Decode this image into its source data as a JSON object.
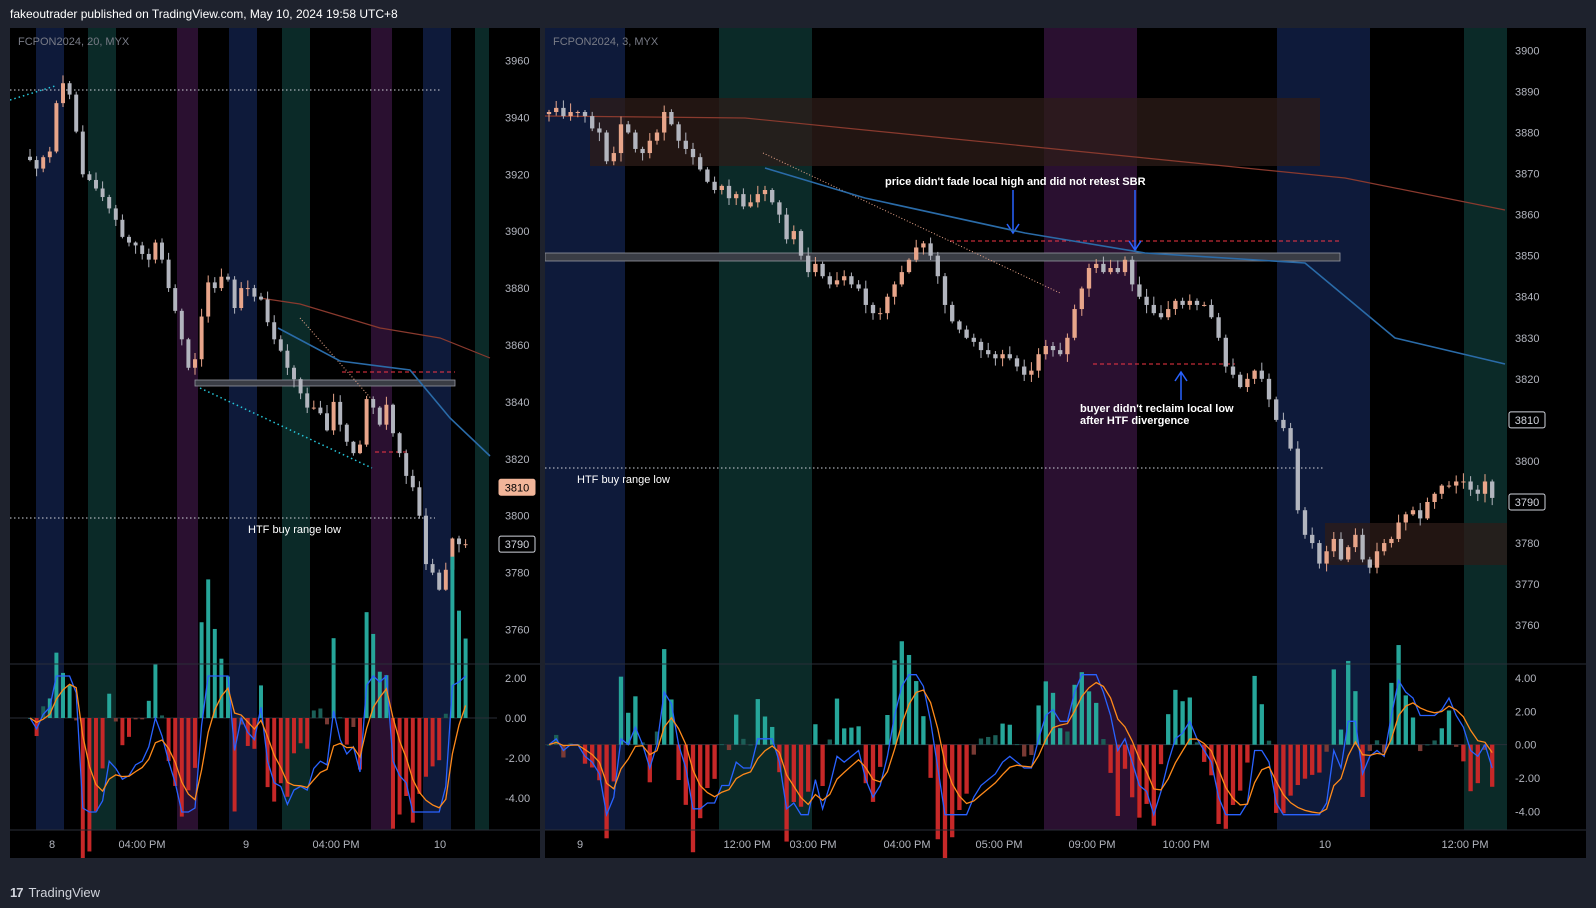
{
  "header": {
    "published": "fakeoutrader published on TradingView.com, May 10, 2024 19:58 UTC+8"
  },
  "footer": {
    "brand": "TradingView",
    "brand_icon": "tradingview-logo-icon"
  },
  "colors": {
    "up": "#e8a58a",
    "down": "#b2b5be",
    "ma_blue": "#2a6ba8",
    "ma_red": "#8a3a2e",
    "session_blue": "#0e1a3a",
    "session_teal": "#0b2a28",
    "session_purple": "#2a1030",
    "macd": "#2962ff",
    "signal": "#ff8a1a",
    "label_box": "#f2b599"
  },
  "chart_data": [
    {
      "type": "candlestick",
      "symbol_label": "FCPON2024, 20, MYX",
      "ylim": [
        3750,
        3970
      ],
      "y_ticks": [
        3760,
        3780,
        3800,
        3820,
        3840,
        3860,
        3880,
        3900,
        3920,
        3940,
        3960
      ],
      "x_ticks": [
        "8",
        "04:00 PM",
        "9",
        "04:00 PM",
        "10"
      ],
      "price_labels": [
        3810,
        3790
      ],
      "annotations": [
        "HTF buy range low"
      ],
      "oscillator": {
        "ylim": [
          -5.5,
          2.5
        ],
        "ticks": [
          "2.00",
          "0.00",
          "-2.00",
          "-4.00"
        ]
      },
      "close_series": [
        3925,
        3922,
        3926,
        3928,
        3945,
        3952,
        3948,
        3935,
        3920,
        3918,
        3915,
        3912,
        3908,
        3904,
        3898,
        3896,
        3895,
        3892,
        3890,
        3896,
        3890,
        3880,
        3872,
        3862,
        3852,
        3855,
        3870,
        3882,
        3880,
        3884,
        3883,
        3873,
        3880,
        3880,
        3877,
        3876,
        3868,
        3862,
        3858,
        3852,
        3848,
        3843,
        3838,
        3838,
        3836,
        3830,
        3840,
        3832,
        3826,
        3822,
        3825,
        3841,
        3838,
        3832,
        3839,
        3829,
        3822,
        3814,
        3810,
        3800,
        3783,
        3780,
        3774,
        3781,
        3792,
        3790,
        3790
      ]
    },
    {
      "type": "candlestick",
      "symbol_label": "FCPON2024, 3, MYX",
      "ylim": [
        3752,
        3904
      ],
      "y_ticks": [
        3760,
        3770,
        3780,
        3790,
        3800,
        3810,
        3820,
        3830,
        3840,
        3850,
        3860,
        3870,
        3880,
        3890,
        3900
      ],
      "x_ticks": [
        "9",
        "12:00 PM",
        "03:00 PM",
        "04:00 PM",
        "05:00 PM",
        "09:00 PM",
        "10:00 PM",
        "10",
        "12:00 PM"
      ],
      "price_labels": [
        3810,
        3790
      ],
      "annotations": [
        "price didn't fade local high and did not retest SBR",
        "buyer didn't reclaim local low",
        "after HTF divergence",
        "HTF buy range low"
      ],
      "oscillator": {
        "ylim": [
          -5,
          4.6
        ],
        "ticks": [
          "4.00",
          "2.00",
          "0.00",
          "-2.00",
          "-4.00"
        ]
      },
      "close_series": [
        3885,
        3886,
        3884,
        3885,
        3885,
        3884,
        3881,
        3880,
        3873,
        3875,
        3882,
        3880,
        3876,
        3875,
        3878,
        3880,
        3885,
        3882,
        3878,
        3876,
        3874,
        3871,
        3868,
        3866,
        3867,
        3864,
        3865,
        3862,
        3863,
        3865,
        3866,
        3863,
        3860,
        3854,
        3856,
        3850,
        3846,
        3848,
        3845,
        3843,
        3844,
        3845,
        3843,
        3842,
        3838,
        3836,
        3836,
        3840,
        3843,
        3846,
        3849,
        3852,
        3853,
        3850,
        3845,
        3838,
        3834,
        3832,
        3830,
        3829,
        3827,
        3826,
        3825,
        3826,
        3825,
        3823,
        3821,
        3822,
        3826,
        3828,
        3827,
        3826,
        3830,
        3837,
        3842,
        3847,
        3848,
        3846,
        3847,
        3846,
        3849,
        3843,
        3840,
        3838,
        3836,
        3835,
        3837,
        3839,
        3838,
        3839,
        3838,
        3838,
        3835,
        3830,
        3823,
        3821,
        3818,
        3820,
        3822,
        3820,
        3815,
        3810,
        3808,
        3803,
        3788,
        3782,
        3780,
        3775,
        3778,
        3781,
        3776,
        3779,
        3782,
        3776,
        3774,
        3778,
        3780,
        3781,
        3785,
        3787,
        3788,
        3786,
        3790,
        3792,
        3794,
        3794,
        3795,
        3795,
        3793,
        3792,
        3795,
        3791
      ]
    }
  ]
}
